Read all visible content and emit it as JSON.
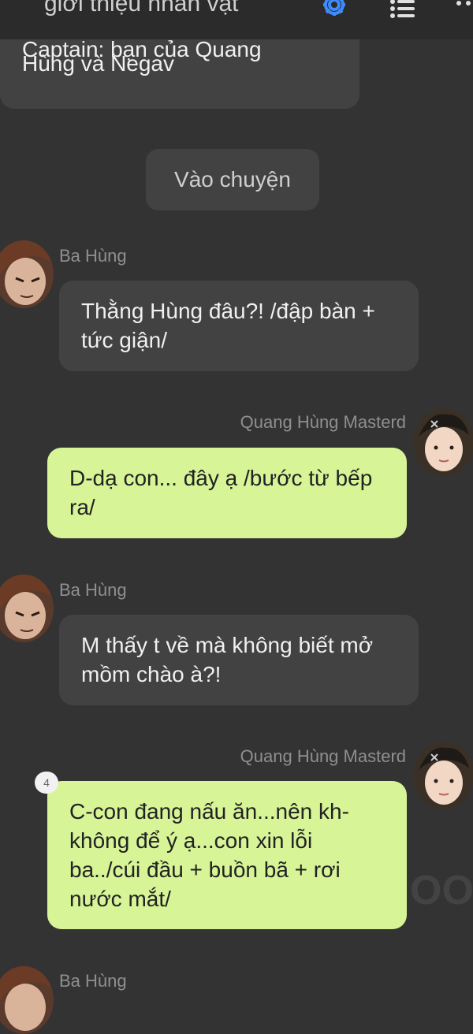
{
  "header": {
    "title": "giới thiệu nhân vật",
    "settings_icon": "gear-icon",
    "menu_icon": "list-icon",
    "more_icon": "more-dots-icon"
  },
  "intro": {
    "cut_text": "Captain: bạn của Quang",
    "last_line": "Hùng và Negav"
  },
  "enter_button": "Vào chuyện",
  "messages": [
    {
      "sender": "Ba Hùng",
      "side": "left",
      "text": "Thằng Hùng đâu?! /đập bàn + tức giận/"
    },
    {
      "sender": "Quang Hùng Masterd",
      "side": "right",
      "text": "D-dạ con... đây ạ /bước từ bếp ra/"
    },
    {
      "sender": "Ba Hùng",
      "side": "left",
      "text": "M thấy t về mà không biết mở mồm chào à?!"
    },
    {
      "sender": "Quang Hùng Masterd",
      "side": "right",
      "text": "C-con đang nấu ăn...nên kh-không để ý ạ...con xin lỗi ba../cúi đầu + buồn bã + rơi nước mắt/",
      "badge": "4"
    },
    {
      "sender": "Ba Hùng",
      "side": "left",
      "text": ""
    }
  ],
  "watermark": "OON",
  "colors": {
    "background": "#333333",
    "left_bubble": "#424242",
    "right_bubble": "#d7f497",
    "accent": "#3d8bfd"
  }
}
